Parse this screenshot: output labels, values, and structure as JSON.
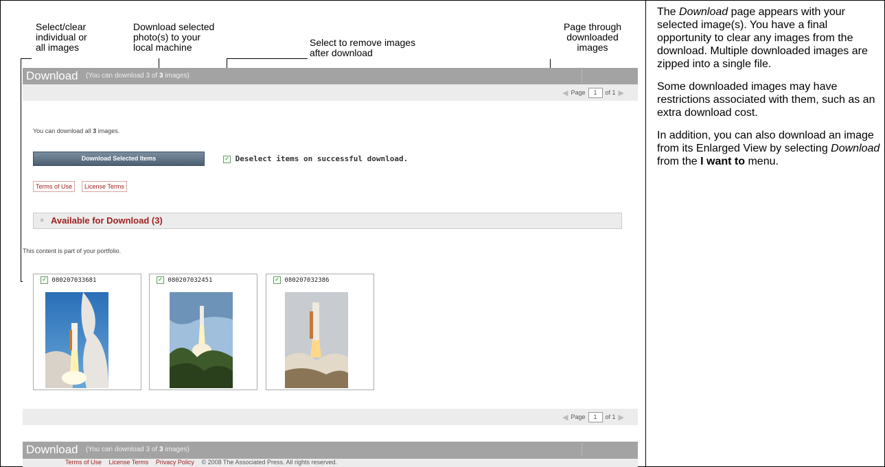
{
  "callouts": {
    "select_clear": [
      "Select/clear",
      "individual or",
      "all images"
    ],
    "download_selected": [
      "Download selected",
      "photo(s) to your",
      "local machine"
    ],
    "remove_after": [
      "Select to remove images",
      "after download"
    ],
    "page_through": [
      "Page through",
      "downloaded",
      "images"
    ]
  },
  "app": {
    "title": "Download",
    "subtitle_pre": "(You can download 3 of ",
    "subtitle_bold": "3",
    "subtitle_post": " images)",
    "pager": {
      "page_label": "Page",
      "page_value": "1",
      "of_label": "of 1"
    },
    "info_pre": "You can download all ",
    "info_bold": "3",
    "info_post": " images.",
    "download_button": "Download Selected Items",
    "deselect_label": "Deselect items on successful download.",
    "terms_of_use": "Terms of Use",
    "license_terms": "License Terms",
    "section_title": "Available for Download (3)",
    "portfolio_note": "This content is part of your portfolio.",
    "images": [
      {
        "id": "080207033681"
      },
      {
        "id": "080207032451"
      },
      {
        "id": "080207032386"
      }
    ],
    "footer": {
      "terms": "Terms of Use",
      "license": "License Terms",
      "privacy": "Privacy Policy",
      "copyright": "© 2008 The Associated Press. All rights reserved."
    }
  },
  "description": {
    "p1_em": "Download",
    "p1_pre": "The ",
    "p1_post": " page appears with your selected image(s). You have a final opportunity to clear any images from the download. Multiple downloaded images are zipped into a single file.",
    "p2": "Some downloaded images may have restrictions associated with them, such as an extra download cost.",
    "p3_pre": "In addition, you can also download an image from its Enlarged View by selecting ",
    "p3_em": "Download",
    "p3_mid": " from the ",
    "p3_bold": "I want to",
    "p3_post": " menu."
  },
  "colors": {
    "titlebar": "#a3a3a3",
    "toolbar": "#ececec",
    "link_red": "#a02020",
    "button": "#4d6072"
  }
}
